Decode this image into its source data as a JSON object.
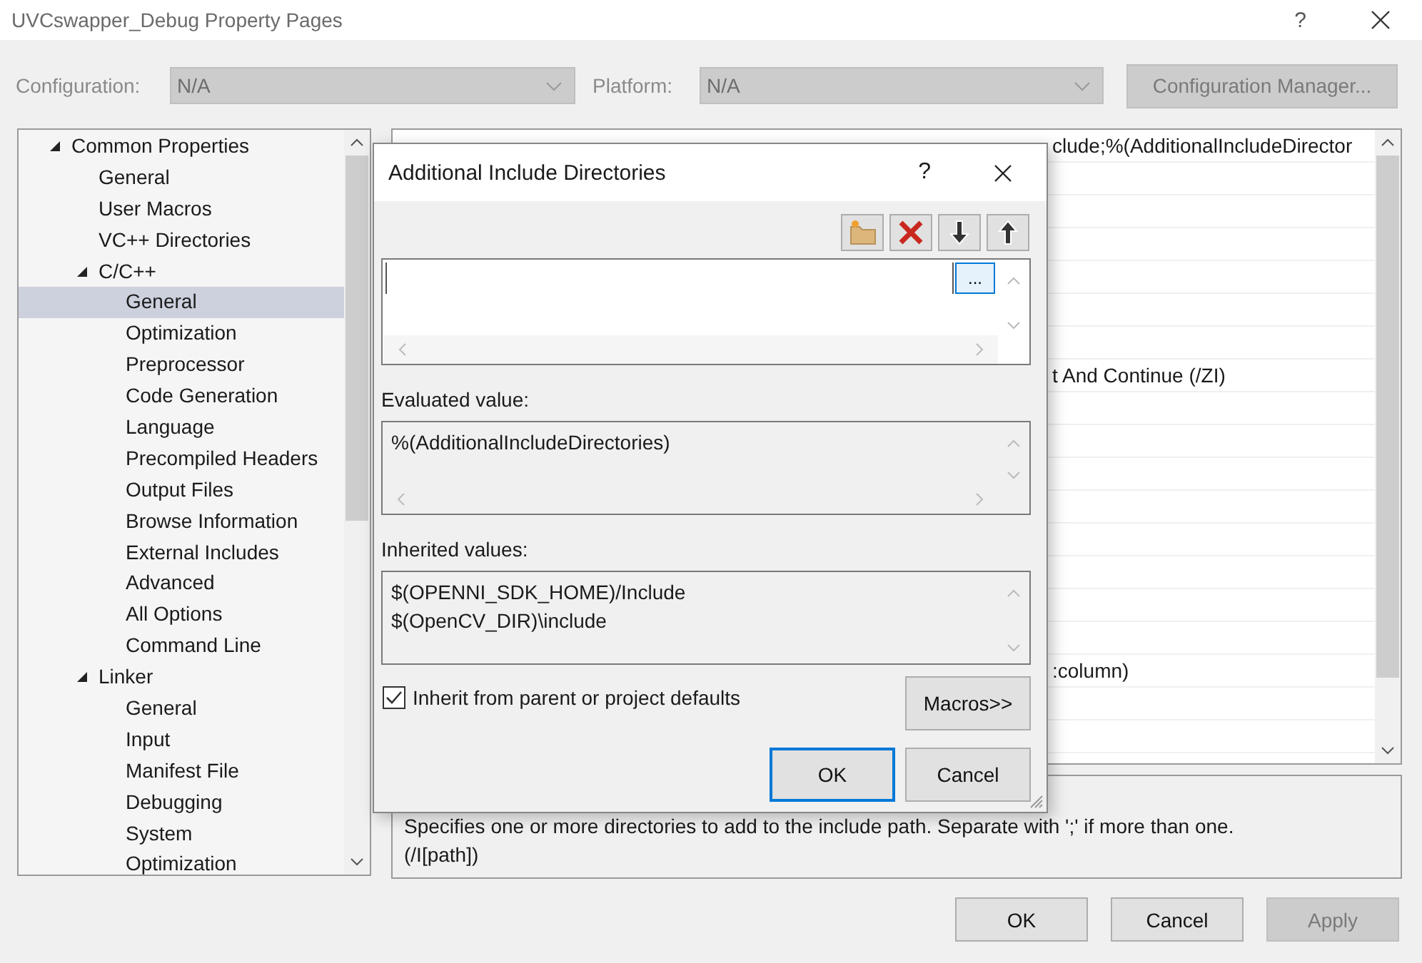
{
  "window": {
    "title": "UVCswapper_Debug Property Pages",
    "help": "?"
  },
  "config_bar": {
    "configuration": {
      "label": "Configuration:",
      "value": "N/A",
      "disabled": true
    },
    "platform": {
      "label": "Platform:",
      "value": "N/A",
      "disabled": true
    },
    "manager_button": {
      "label": "Configuration Manager...",
      "disabled": true
    }
  },
  "tree": {
    "items": [
      {
        "label": "Common Properties",
        "selected": false,
        "expanded": true,
        "children": [
          {
            "label": "General",
            "selected": false
          },
          {
            "label": "User Macros",
            "selected": false
          },
          {
            "label": "VC++ Directories",
            "selected": false
          },
          {
            "label": "C/C++",
            "selected": false,
            "expanded": true,
            "children": [
              {
                "label": "General",
                "selected": true
              },
              {
                "label": "Optimization",
                "selected": false
              },
              {
                "label": "Preprocessor",
                "selected": false
              },
              {
                "label": "Code Generation",
                "selected": false
              },
              {
                "label": "Language",
                "selected": false
              },
              {
                "label": "Precompiled Headers",
                "selected": false
              },
              {
                "label": "Output Files",
                "selected": false
              },
              {
                "label": "Browse Information",
                "selected": false
              },
              {
                "label": "External Includes",
                "selected": false
              },
              {
                "label": "Advanced",
                "selected": false
              },
              {
                "label": "All Options",
                "selected": false
              },
              {
                "label": "Command Line",
                "selected": false
              }
            ]
          },
          {
            "label": "Linker",
            "selected": false,
            "expanded": true,
            "children": [
              {
                "label": "General",
                "selected": false
              },
              {
                "label": "Input",
                "selected": false
              },
              {
                "label": "Manifest File",
                "selected": false
              },
              {
                "label": "Debugging",
                "selected": false
              },
              {
                "label": "System",
                "selected": false
              },
              {
                "label": "Optimization",
                "selected": false
              }
            ]
          }
        ]
      }
    ]
  },
  "grid": {
    "rows": [
      {
        "value": "clude;%(AdditionalIncludeDirector"
      },
      {},
      {},
      {},
      {},
      {},
      {},
      {
        "value": "t And Continue (/ZI)"
      },
      {},
      {},
      {},
      {},
      {},
      {},
      {},
      {},
      {
        "value": ":column)"
      },
      {},
      {}
    ]
  },
  "description": {
    "text": "Specifies one or more directories to add to the include path. Separate with ';' if more than one. (/I[path])"
  },
  "buttons": [
    {
      "label": "OK",
      "disabled": false
    },
    {
      "label": "Cancel",
      "disabled": false
    },
    {
      "label": "Apply",
      "disabled": true
    }
  ],
  "dialog": {
    "title": "Additional Include Directories",
    "help": "?",
    "toolbar": [
      {
        "kind": "new-folder"
      },
      {
        "kind": "delete"
      },
      {
        "kind": "move-down"
      },
      {
        "kind": "move-up"
      }
    ],
    "edit_list": {
      "browse_button": "..."
    },
    "evaluated": {
      "label": "Evaluated value:",
      "text": "%(AdditionalIncludeDirectories)"
    },
    "inherited": {
      "label": "Inherited values:",
      "lines": [
        "$(OPENNI_SDK_HOME)/Include",
        "$(OpenCV_DIR)\\include"
      ]
    },
    "inherit_checkbox": {
      "label": "Inherit from parent or project defaults",
      "checked": true
    },
    "macros_button": "Macros>>",
    "buttons": [
      {
        "label": "OK",
        "focused": true
      },
      {
        "label": "Cancel",
        "focused": false
      }
    ]
  }
}
